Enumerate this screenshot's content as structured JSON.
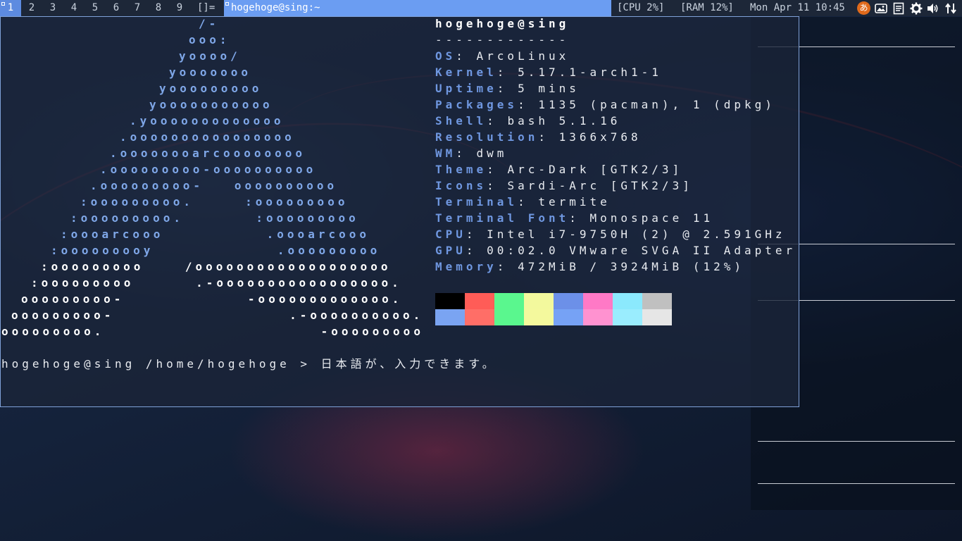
{
  "bar": {
    "tags": [
      "1",
      "2",
      "3",
      "4",
      "5",
      "6",
      "7",
      "8",
      "9"
    ],
    "active_tag": "1",
    "layout_symbol": "[]=",
    "window_title": "hogehoge@sing:~",
    "cpu": "[CPU 2%]",
    "ram": "[RAM 12%]",
    "datetime": "Mon Apr 11 10:45",
    "tray_icons": [
      "ime-icon",
      "photo-icon",
      "clipboard-icon",
      "gear-icon",
      "volume-icon",
      "network-icon"
    ],
    "ime_label": "あ"
  },
  "ascii_art": [
    "/-",
    "ooo:",
    "yoooo/",
    "yooooooo",
    "yooooooooo",
    "yooooooooooo",
    ".yooooooooooooo",
    ".oooooooooooooooo",
    ".oooooooarcoooooooo",
    ".ooooooooo-oooooooooo",
    ".ooooooooo-   oooooooooo",
    ":ooooooooo.     :ooooooooo",
    ":ooooooooo.       :ooooooooo",
    ":oooarcooo          .oooarcooo",
    ":ooooooooy            .ooooooooo",
    ":ooooooooo    /ooooooooooooooooooo",
    ":ooooooooo      .-ooooooooooooooooo.",
    "ooooooooo-            -ooooooooooooo.",
    "ooooooooo-                 .-oooooooooo.",
    "ooooooooo.                     -ooooooooo"
  ],
  "fetch": {
    "title": "hogehoge@sing",
    "separator": "-------------",
    "rows": [
      {
        "key": "OS",
        "value": "ArcoLinux"
      },
      {
        "key": "Kernel",
        "value": "5.17.1-arch1-1"
      },
      {
        "key": "Uptime",
        "value": "5 mins"
      },
      {
        "key": "Packages",
        "value": "1135 (pacman), 1 (dpkg)"
      },
      {
        "key": "Shell",
        "value": "bash 5.1.16"
      },
      {
        "key": "Resolution",
        "value": "1366x768"
      },
      {
        "key": "WM",
        "value": "dwm"
      },
      {
        "key": "Theme",
        "value": "Arc-Dark [GTK2/3]"
      },
      {
        "key": "Icons",
        "value": "Sardi-Arc [GTK2/3]"
      },
      {
        "key": "Terminal",
        "value": "termite"
      },
      {
        "key": "Terminal Font",
        "value": "Monospace 11"
      },
      {
        "key": "CPU",
        "value": "Intel i7-9750H (2) @ 2.591GHz"
      },
      {
        "key": "GPU",
        "value": "00:02.0 VMware SVGA II Adapter"
      },
      {
        "key": "Memory",
        "value": "472MiB / 3924MiB (12%)"
      }
    ],
    "colors_top": [
      "#000000",
      "#ff5c57",
      "#5af78e",
      "#f3f99d",
      "#6c90e8",
      "#ff79c6",
      "#8be9fd",
      "#c0c0c0"
    ],
    "colors_bottom": [
      "#7aa4f2",
      "#ff6e67",
      "#5af78e",
      "#f4f99d",
      "#76a2f5",
      "#ff92d0",
      "#9aedfe",
      "#e6e6e6"
    ]
  },
  "prompt": {
    "text": "hogehoge@sing /home/hogehoge > 日本語が、入力できます。"
  }
}
